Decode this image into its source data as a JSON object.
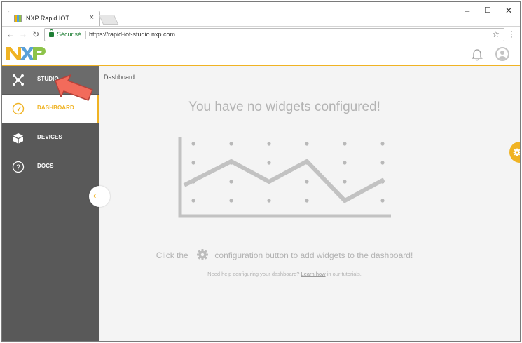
{
  "browser": {
    "tab_title": "NXP Rapid IOT",
    "tab_close": "×",
    "security_label": "Sécurisé",
    "url": "https://rapid-iot-studio.nxp.com",
    "controls": {
      "minimize": "–",
      "maximize": "☐",
      "close": "✕"
    }
  },
  "app": {
    "logo_text": "NXP",
    "brand_colors": {
      "yellow": "#f0b323",
      "blue": "#5aa0d8",
      "green": "#8dc34a"
    }
  },
  "sidebar": {
    "items": [
      {
        "label": "STUDIO",
        "icon": "network-icon"
      },
      {
        "label": "DASHBOARD",
        "icon": "gauge-icon",
        "active": true
      },
      {
        "label": "DEVICES",
        "icon": "cube-icon"
      },
      {
        "label": "DOCS",
        "icon": "help-circle-icon"
      }
    ],
    "collapse_glyph": "‹"
  },
  "main": {
    "breadcrumb": "Dashboard",
    "empty_title": "You have no widgets configured!",
    "hint_before": "Click the",
    "hint_after": "configuration button to add widgets to the dashboard!",
    "help_before": "Need help configuring your dashboard?",
    "help_link": "Learn how",
    "help_after": "in our tutorials."
  },
  "colors": {
    "accent": "#f0b323",
    "sidebar_bg": "#595959",
    "main_bg": "#f4f4f4",
    "placeholder_gray": "#b3b3b3",
    "annotation_arrow": "#f26b5b"
  }
}
